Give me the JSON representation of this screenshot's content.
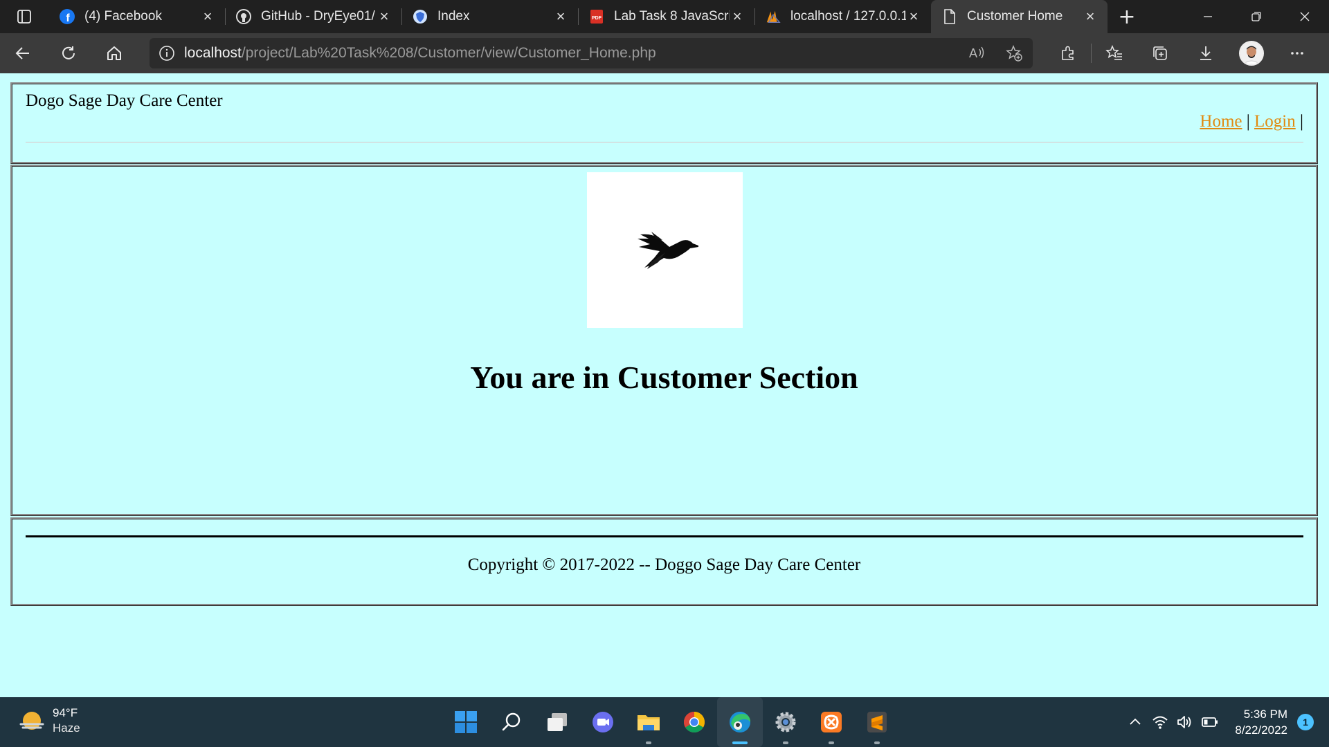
{
  "browser": {
    "tabs": [
      {
        "title": "(4) Facebook",
        "icon": "facebook-icon",
        "active": false
      },
      {
        "title": "GitHub - DryEye01/",
        "icon": "github-icon",
        "active": false
      },
      {
        "title": "Index",
        "icon": "shield-icon",
        "active": false
      },
      {
        "title": "Lab Task 8 JavaScrip",
        "icon": "pdf-icon",
        "active": false
      },
      {
        "title": "localhost / 127.0.0.1",
        "icon": "phpmyadmin-icon",
        "active": false
      },
      {
        "title": "Customer Home",
        "icon": "page-icon",
        "active": true
      }
    ],
    "address": {
      "host": "localhost",
      "path": "/project/Lab%20Task%208/Customer/view/Customer_Home.php"
    }
  },
  "page": {
    "brand": "Dogo Sage Day Care Center",
    "nav": {
      "home": "Home",
      "login": "Login",
      "separator": "|"
    },
    "heading": "You are in Customer Section",
    "copyright": "Copyright © 2017-2022 -- Doggo Sage Day Care Center"
  },
  "taskbar": {
    "weather": {
      "temp": "94°F",
      "condition": "Haze"
    },
    "clock": {
      "time": "5:36 PM",
      "date": "8/22/2022"
    },
    "notifications": "1"
  },
  "colors": {
    "page_bg": "#c7fffe",
    "link": "#e08a10",
    "accent": "#4cc2ff"
  }
}
